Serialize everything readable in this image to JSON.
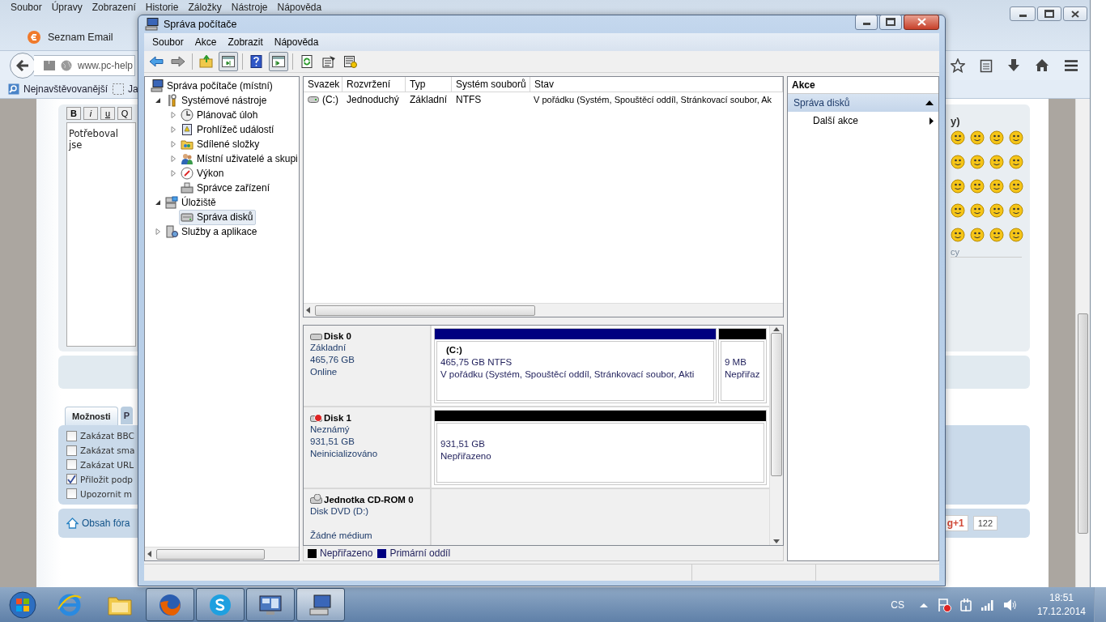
{
  "browser": {
    "menu": [
      "Soubor",
      "Úpravy",
      "Zobrazení",
      "Historie",
      "Záložky",
      "Nástroje",
      "Nápověda"
    ],
    "tab": {
      "label": "Seznam Email"
    },
    "address": {
      "value": "www.pc-help"
    },
    "bookmarks": [
      {
        "label": "Nejnavštěvovanější",
        "kind": "smart"
      },
      {
        "label": "Ja",
        "kind": "page"
      }
    ],
    "page": {
      "format_buttons": [
        {
          "label": "B",
          "kind": "bold"
        },
        {
          "label": "i",
          "kind": "italic"
        },
        {
          "label": "u",
          "kind": "underline"
        },
        {
          "label": "Q",
          "kind": "plain"
        }
      ],
      "message": "Potřeboval jse",
      "smileys_heading": "y)",
      "smileys_more": "cy",
      "option_tabs": [
        {
          "label": "Možnosti",
          "selected": true
        },
        {
          "label": "P",
          "selected": false
        }
      ],
      "options": [
        {
          "label": "Zakázat BBC",
          "checked": false
        },
        {
          "label": "Zakázat sma",
          "checked": false
        },
        {
          "label": "Zakázat URL",
          "checked": false
        },
        {
          "label": "Přiložit podp",
          "checked": true
        },
        {
          "label": "Upozornit m",
          "checked": false
        }
      ],
      "forum_link": "Obsah fóra",
      "gplus": {
        "label": "g+1",
        "count": "122"
      }
    }
  },
  "mmc": {
    "title": "Správa počítače",
    "menu": [
      "Soubor",
      "Akce",
      "Zobrazit",
      "Nápověda"
    ],
    "toolbar": [
      {
        "kind": "back",
        "pressed": false
      },
      {
        "kind": "forward",
        "pressed": false
      },
      {
        "kind": "up",
        "pressed": false
      },
      {
        "kind": "tree-toggle",
        "pressed": true
      },
      {
        "kind": "help",
        "pressed": false
      },
      {
        "kind": "pane-toggle",
        "pressed": true
      },
      {
        "kind": "refresh",
        "pressed": false
      },
      {
        "kind": "properties",
        "pressed": false
      },
      {
        "kind": "export",
        "pressed": false
      }
    ],
    "tree": [
      {
        "label": "Správa počítače (místní)",
        "kind": "computer",
        "selected": false,
        "children": [
          {
            "label": "Systémové nástroje",
            "kind": "tools",
            "expanded": true,
            "selected": false,
            "children": [
              {
                "label": "Plánovač úloh",
                "kind": "clock",
                "expanded": false,
                "selected": false
              },
              {
                "label": "Prohlížeč událostí",
                "kind": "log",
                "expanded": false,
                "selected": false
              },
              {
                "label": "Sdílené složky",
                "kind": "share",
                "expanded": false,
                "selected": false
              },
              {
                "label": "Místní uživatelé a skupi",
                "kind": "users",
                "expanded": false,
                "selected": false
              },
              {
                "label": "Výkon",
                "kind": "gauge",
                "expanded": false,
                "selected": false
              },
              {
                "label": "Správce zařízení",
                "kind": "device",
                "selected": false
              }
            ]
          },
          {
            "label": "Úložiště",
            "kind": "storage",
            "expanded": true,
            "selected": false,
            "children": [
              {
                "label": "Správa disků",
                "kind": "disk",
                "selected": true
              }
            ]
          },
          {
            "label": "Služby a aplikace",
            "kind": "services",
            "expanded": false,
            "selected": false
          }
        ]
      }
    ],
    "volumes": {
      "columns": [
        "Svazek",
        "Rozvržení",
        "Typ",
        "Systém souborů",
        "Stav"
      ],
      "rows": [
        [
          "(C:)",
          "Jednoduchý",
          "Základní",
          "NTFS",
          "V pořádku (Systém, Spouštěcí oddíl, Stránkovací soubor, Ak"
        ]
      ]
    },
    "disks": [
      {
        "name": "Disk 0",
        "kind": "disk",
        "lines": [
          "Základní",
          "465,76 GB",
          "Online"
        ],
        "partitions": [
          {
            "kind": "fill",
            "color": "#000080",
            "label": "(C:)",
            "lines": [
              "465,75 GB NTFS",
              "V pořádku (Systém, Spouštěcí oddíl, Stránkovací soubor, Akti"
            ]
          },
          {
            "kind": "narrow",
            "color": "#000000",
            "lines": [
              "9 MB",
              "Nepřiřaz"
            ]
          }
        ]
      },
      {
        "name": "Disk 1",
        "kind": "disk-error",
        "lines": [
          "Neznámý",
          "931,51 GB",
          "Neinicializováno"
        ],
        "partitions": [
          {
            "kind": "fill",
            "color": "#000000",
            "lines": [
              "931,51 GB",
              "Nepřiřazeno"
            ]
          }
        ]
      },
      {
        "name": "Jednotka CD-ROM 0",
        "kind": "cdrom",
        "lines": [
          "Disk DVD (D:)"
        ],
        "status": "Žádné médium"
      }
    ],
    "legend": [
      {
        "label": "Nepřiřazeno",
        "color": "#000000"
      },
      {
        "label": "Primární oddíl",
        "color": "#000080"
      }
    ],
    "actions": {
      "title": "Akce",
      "section": {
        "label": "Správa disků",
        "expanded": true
      },
      "items": [
        "Další akce"
      ]
    }
  },
  "taskbar": {
    "apps": [
      {
        "kind": "ie",
        "open": false,
        "selected": false
      },
      {
        "kind": "explorer",
        "open": false,
        "selected": false
      },
      {
        "kind": "firefox",
        "open": true,
        "selected": false
      },
      {
        "kind": "skype",
        "open": true,
        "selected": false
      },
      {
        "kind": "remote",
        "open": true,
        "selected": false
      },
      {
        "kind": "mmc",
        "open": true,
        "selected": true
      }
    ],
    "language": "CS",
    "time": "18:51",
    "date": "17.12.2014"
  }
}
